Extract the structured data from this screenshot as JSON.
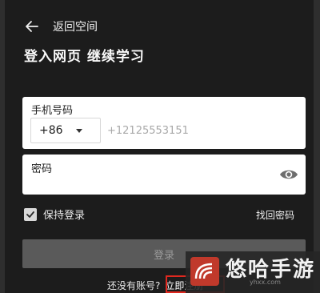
{
  "header": {
    "back_label": "返回空间",
    "title": "登入网页 继续学习"
  },
  "phone": {
    "label": "手机号码",
    "country_code": "+86",
    "placeholder": "+12125553151"
  },
  "password": {
    "label": "密码",
    "placeholder": ""
  },
  "options": {
    "remember_label": "保持登录",
    "remember_checked": true,
    "forgot_label": "找回密码"
  },
  "login_button_label": "登录",
  "signup": {
    "prompt": "还没有账号?",
    "link_label": "立即注册"
  },
  "watermark": {
    "text": "悠哈手游",
    "url": "yhxx.com"
  },
  "colors": {
    "panel_bg": "#1c1c1c",
    "outer_bg": "#2e2e2e",
    "login_button_bg": "#5a5a5a",
    "highlight_border": "#e0281f"
  },
  "icons": [
    "back-arrow-icon",
    "chevron-down-icon",
    "eye-icon",
    "check-icon"
  ]
}
